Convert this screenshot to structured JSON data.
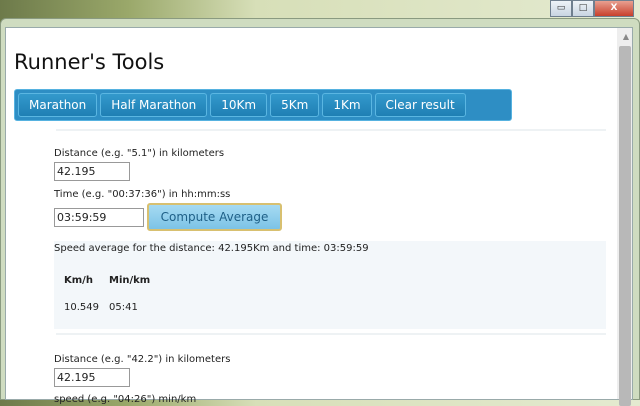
{
  "window": {
    "minimize": "▭",
    "maximize": "□",
    "close": "X"
  },
  "page": {
    "title": "Runner's Tools"
  },
  "nav": [
    "Marathon",
    "Half Marathon",
    "10Km",
    "5Km",
    "1Km",
    "Clear result"
  ],
  "average": {
    "distance_label": "Distance (e.g. \"5.1\") in kilometers",
    "distance_value": "42.195",
    "time_label": "Time (e.g. \"00:37:36\") in hh:mm:ss",
    "time_value": "03:59:59",
    "compute_label": "Compute Average",
    "result_text": "Speed average for the distance: 42.195Km and time: 03:59:59",
    "headers": [
      "Km/h",
      "Min/km"
    ],
    "values": [
      "10.549",
      "05:41"
    ]
  },
  "second": {
    "distance_label": "Distance (e.g. \"42.2\") in kilometers",
    "distance_value": "42.195",
    "speed_label": "speed (e.g. \"04:26\") min/km"
  }
}
